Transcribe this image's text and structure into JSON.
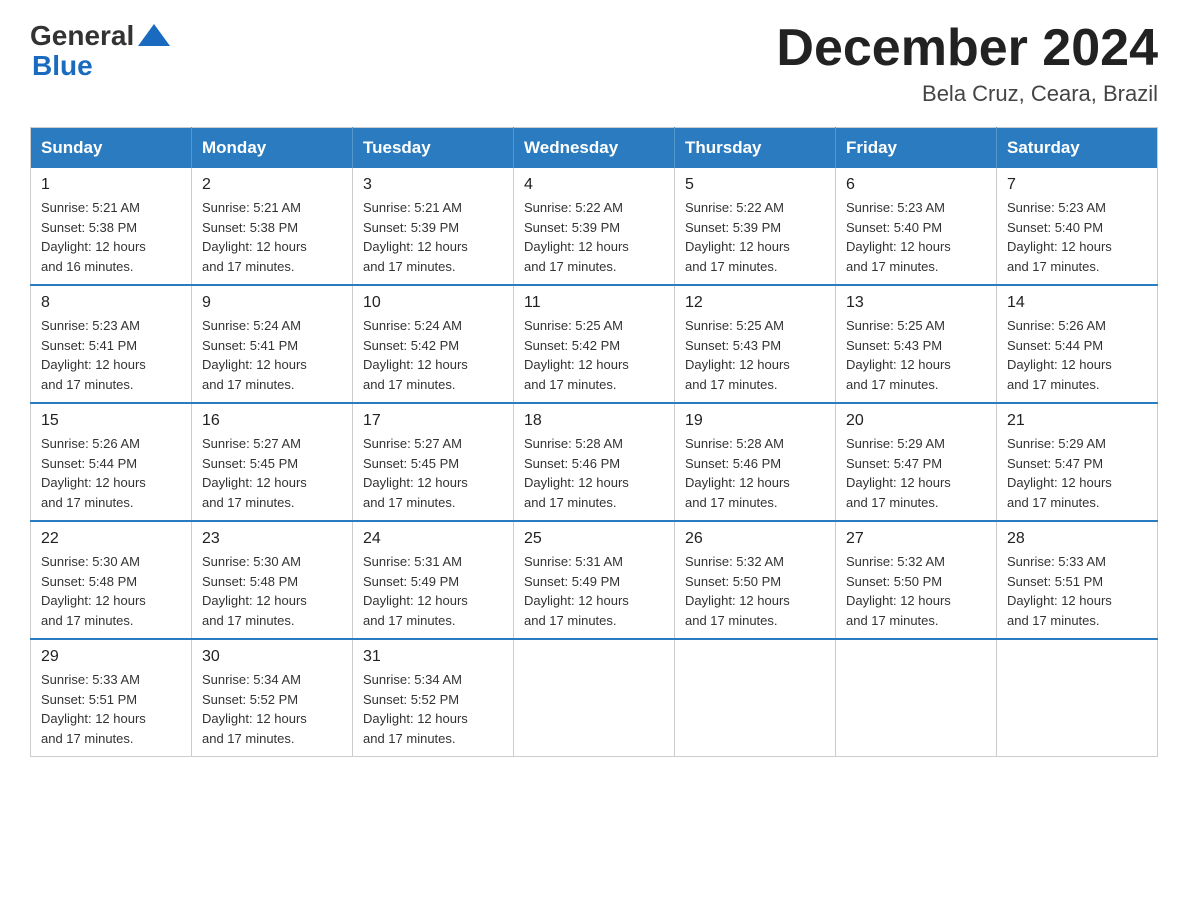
{
  "header": {
    "logo_general": "General",
    "logo_blue": "Blue",
    "month_title": "December 2024",
    "location": "Bela Cruz, Ceara, Brazil"
  },
  "days_of_week": [
    "Sunday",
    "Monday",
    "Tuesday",
    "Wednesday",
    "Thursday",
    "Friday",
    "Saturday"
  ],
  "weeks": [
    [
      {
        "day": "1",
        "sunrise": "5:21 AM",
        "sunset": "5:38 PM",
        "daylight": "12 hours and 16 minutes."
      },
      {
        "day": "2",
        "sunrise": "5:21 AM",
        "sunset": "5:38 PM",
        "daylight": "12 hours and 17 minutes."
      },
      {
        "day": "3",
        "sunrise": "5:21 AM",
        "sunset": "5:39 PM",
        "daylight": "12 hours and 17 minutes."
      },
      {
        "day": "4",
        "sunrise": "5:22 AM",
        "sunset": "5:39 PM",
        "daylight": "12 hours and 17 minutes."
      },
      {
        "day": "5",
        "sunrise": "5:22 AM",
        "sunset": "5:39 PM",
        "daylight": "12 hours and 17 minutes."
      },
      {
        "day": "6",
        "sunrise": "5:23 AM",
        "sunset": "5:40 PM",
        "daylight": "12 hours and 17 minutes."
      },
      {
        "day": "7",
        "sunrise": "5:23 AM",
        "sunset": "5:40 PM",
        "daylight": "12 hours and 17 minutes."
      }
    ],
    [
      {
        "day": "8",
        "sunrise": "5:23 AM",
        "sunset": "5:41 PM",
        "daylight": "12 hours and 17 minutes."
      },
      {
        "day": "9",
        "sunrise": "5:24 AM",
        "sunset": "5:41 PM",
        "daylight": "12 hours and 17 minutes."
      },
      {
        "day": "10",
        "sunrise": "5:24 AM",
        "sunset": "5:42 PM",
        "daylight": "12 hours and 17 minutes."
      },
      {
        "day": "11",
        "sunrise": "5:25 AM",
        "sunset": "5:42 PM",
        "daylight": "12 hours and 17 minutes."
      },
      {
        "day": "12",
        "sunrise": "5:25 AM",
        "sunset": "5:43 PM",
        "daylight": "12 hours and 17 minutes."
      },
      {
        "day": "13",
        "sunrise": "5:25 AM",
        "sunset": "5:43 PM",
        "daylight": "12 hours and 17 minutes."
      },
      {
        "day": "14",
        "sunrise": "5:26 AM",
        "sunset": "5:44 PM",
        "daylight": "12 hours and 17 minutes."
      }
    ],
    [
      {
        "day": "15",
        "sunrise": "5:26 AM",
        "sunset": "5:44 PM",
        "daylight": "12 hours and 17 minutes."
      },
      {
        "day": "16",
        "sunrise": "5:27 AM",
        "sunset": "5:45 PM",
        "daylight": "12 hours and 17 minutes."
      },
      {
        "day": "17",
        "sunrise": "5:27 AM",
        "sunset": "5:45 PM",
        "daylight": "12 hours and 17 minutes."
      },
      {
        "day": "18",
        "sunrise": "5:28 AM",
        "sunset": "5:46 PM",
        "daylight": "12 hours and 17 minutes."
      },
      {
        "day": "19",
        "sunrise": "5:28 AM",
        "sunset": "5:46 PM",
        "daylight": "12 hours and 17 minutes."
      },
      {
        "day": "20",
        "sunrise": "5:29 AM",
        "sunset": "5:47 PM",
        "daylight": "12 hours and 17 minutes."
      },
      {
        "day": "21",
        "sunrise": "5:29 AM",
        "sunset": "5:47 PM",
        "daylight": "12 hours and 17 minutes."
      }
    ],
    [
      {
        "day": "22",
        "sunrise": "5:30 AM",
        "sunset": "5:48 PM",
        "daylight": "12 hours and 17 minutes."
      },
      {
        "day": "23",
        "sunrise": "5:30 AM",
        "sunset": "5:48 PM",
        "daylight": "12 hours and 17 minutes."
      },
      {
        "day": "24",
        "sunrise": "5:31 AM",
        "sunset": "5:49 PM",
        "daylight": "12 hours and 17 minutes."
      },
      {
        "day": "25",
        "sunrise": "5:31 AM",
        "sunset": "5:49 PM",
        "daylight": "12 hours and 17 minutes."
      },
      {
        "day": "26",
        "sunrise": "5:32 AM",
        "sunset": "5:50 PM",
        "daylight": "12 hours and 17 minutes."
      },
      {
        "day": "27",
        "sunrise": "5:32 AM",
        "sunset": "5:50 PM",
        "daylight": "12 hours and 17 minutes."
      },
      {
        "day": "28",
        "sunrise": "5:33 AM",
        "sunset": "5:51 PM",
        "daylight": "12 hours and 17 minutes."
      }
    ],
    [
      {
        "day": "29",
        "sunrise": "5:33 AM",
        "sunset": "5:51 PM",
        "daylight": "12 hours and 17 minutes."
      },
      {
        "day": "30",
        "sunrise": "5:34 AM",
        "sunset": "5:52 PM",
        "daylight": "12 hours and 17 minutes."
      },
      {
        "day": "31",
        "sunrise": "5:34 AM",
        "sunset": "5:52 PM",
        "daylight": "12 hours and 17 minutes."
      },
      null,
      null,
      null,
      null
    ]
  ],
  "labels": {
    "sunrise_prefix": "Sunrise: ",
    "sunset_prefix": "Sunset: ",
    "daylight_prefix": "Daylight: "
  }
}
